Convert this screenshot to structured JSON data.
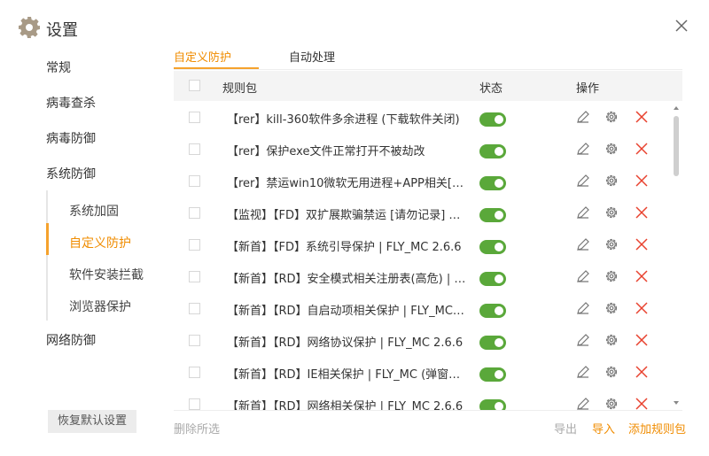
{
  "window": {
    "title": "设置",
    "close_icon": "close-icon",
    "settings_icon": "gear-icon"
  },
  "sidebar": {
    "items": [
      {
        "label": "常规"
      },
      {
        "label": "病毒查杀"
      },
      {
        "label": "病毒防御"
      },
      {
        "label": "系统防御"
      },
      {
        "label": "网络防御"
      }
    ],
    "sub_items": [
      {
        "label": "系统加固",
        "active": false
      },
      {
        "label": "自定义防护",
        "active": true
      },
      {
        "label": "软件安装拦截",
        "active": false
      },
      {
        "label": "浏览器保护",
        "active": false
      }
    ],
    "restore_label": "恢复默认设置"
  },
  "tabs": [
    {
      "label": "自定义防护",
      "active": true
    },
    {
      "label": "自动处理",
      "active": false
    }
  ],
  "table": {
    "headers": {
      "rule": "规则包",
      "status": "状态",
      "actions": "操作"
    },
    "rows": [
      {
        "name": "【rer】kill-360软件多余进程 (下载软件关闭)",
        "enabled": true
      },
      {
        "name": "【rer】保护exe文件正常打开不被劫改",
        "enabled": true
      },
      {
        "name": "【rer】禁运win10微软无用进程+APP相关[影响...",
        "enabled": true
      },
      {
        "name": "【监视】【FD】双扩展欺骗禁运 [请勿记录] or ...",
        "enabled": true
      },
      {
        "name": "【新首】【FD】系统引导保护 | FLY_MC 2.6.6",
        "enabled": true
      },
      {
        "name": "【新首】【RD】安全模式相关注册表(高危) | FL...",
        "enabled": true
      },
      {
        "name": "【新首】【RD】自启动项相关保护 | FLY_MC 2....",
        "enabled": true
      },
      {
        "name": "【新首】【RD】网络协议保护 | FLY_MC  2.6.6",
        "enabled": true
      },
      {
        "name": "【新首】【RD】IE相关保护 | FLY_MC (弹窗较...",
        "enabled": true
      },
      {
        "name": "【新首】【RD】网络相关保护 | FLY_MC  2.6.6",
        "enabled": true
      }
    ]
  },
  "footer": {
    "delete_selected": "删除所选",
    "export": "导出",
    "import": "导入",
    "add_rule": "添加规则包"
  },
  "colors": {
    "accent": "#f08c00",
    "toggle_on": "#5aa83a",
    "delete": "#e8412e"
  }
}
